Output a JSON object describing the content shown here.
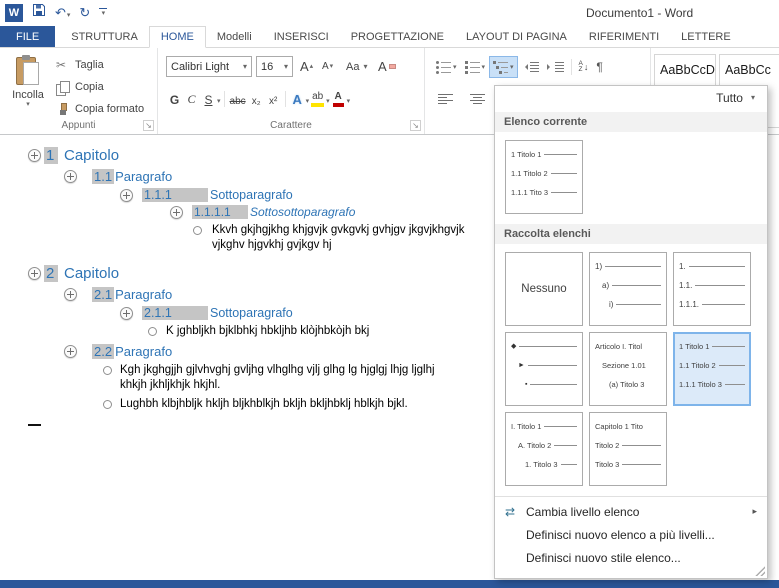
{
  "titlebar": {
    "title": "Documento1 - Word"
  },
  "icons": {
    "word": "W",
    "undo": "↶",
    "redo": "↻",
    "arrow": "▾",
    "up": "▴",
    "scissors": "✂",
    "pilcrow": "¶",
    "sort_a": "A",
    "sort_z": "Z",
    "sort_down": "↓",
    "launcher": "↘",
    "submenu": "▸",
    "change_level": "⇄"
  },
  "tabs": {
    "file": "FILE",
    "items": [
      "STRUTTURA",
      "HOME",
      "Modelli",
      "INSERISCI",
      "PROGETTAZIONE",
      "LAYOUT DI PAGINA",
      "RIFERIMENTI",
      "LETTERE"
    ]
  },
  "ribbon": {
    "clipboard": {
      "paste": "Incolla",
      "cut": "Taglia",
      "copy": "Copia",
      "format_painter": "Copia formato",
      "group": "Appunti"
    },
    "font": {
      "name": "Calibri Light",
      "size": "16",
      "grow": "A",
      "shrink": "A",
      "aa": "Aa",
      "clear": "A",
      "bold": "G",
      "italic": "C",
      "underline": "S",
      "strikethrough": "abc",
      "subscript": "x₂",
      "superscript": "x²",
      "effects": "A",
      "highlight": "ab",
      "color": "A",
      "group": "Carattere"
    },
    "styles": {
      "style1": "AaBbCcDc",
      "style2": "AaBbCc"
    }
  },
  "document": {
    "outline": [
      {
        "kind": "h1",
        "number": "1",
        "text": "Capitolo"
      },
      {
        "kind": "h2",
        "number": "1.1",
        "text": "Paragrafo"
      },
      {
        "kind": "h3",
        "number": "1.1.1",
        "text": "Sottoparagrafo"
      },
      {
        "kind": "h4",
        "number": "1.1.1.1",
        "text": "Sottosottoparagrafo"
      },
      {
        "kind": "body",
        "line1": "Kkvh gkjhgjkhg khjgvjk gvkgvkj gvhjgv jkgvjkhgvjk",
        "line2": "vjkghv hjgvkhj gvjkgv hj"
      },
      {
        "kind": "h1",
        "number": "2",
        "text": "Capitolo"
      },
      {
        "kind": "h2",
        "number": "2.1",
        "text": "Paragrafo"
      },
      {
        "kind": "h3",
        "number": "2.1.1",
        "text": "Sottoparagrafo"
      },
      {
        "kind": "body",
        "line1": "K jghbljkh bjklbhkj hbkljhb klòjhbkòjh bkj"
      },
      {
        "kind": "h2",
        "number": "2.2",
        "text": "Paragrafo"
      },
      {
        "kind": "body",
        "line1": "Kgh jkghgjjh gjlvhvghj gvljhg vlhglhg vjlj glhg lg hjglgj lhjg ljglhj",
        "line2": "khkjh jkhljkhjk hkjhl."
      },
      {
        "kind": "body",
        "line1": "Lughbh klbjhbljk hkljh bljkhblkjh bkljh bkljhbklj hblkjh bjkl."
      }
    ]
  },
  "dropdown": {
    "filter": "Tutto",
    "current_label": "Elenco corrente",
    "gallery_label": "Raccolta elenchi",
    "current": [
      "1 Titolo 1",
      "1.1 Titolo 2",
      "1.1.1 Tito 3"
    ],
    "cells": {
      "none": "Nessuno",
      "numparen": [
        "1)",
        "a)",
        "i)"
      ],
      "numdot": [
        "1.",
        "1.1.",
        "1.1.1."
      ],
      "bullets": [
        "◆",
        "►",
        "▪"
      ],
      "articolo": [
        "Articolo I. Titol",
        "Sezione 1.01",
        "(a) Titolo 3"
      ],
      "titolonum": [
        "1 Titolo 1",
        "1.1 Titolo 2",
        "1.1.1 Titolo 3"
      ],
      "roman": [
        "I. Titolo 1",
        "A. Titolo 2",
        "1. Titolo 3"
      ],
      "capitolo": [
        "Capitolo 1 Tito",
        "Titolo 2",
        "Titolo 3"
      ]
    },
    "menu": [
      {
        "label": "Cambia livello elenco"
      },
      {
        "label": "Definisci nuovo elenco a più livelli..."
      },
      {
        "label": "Definisci nuovo stile elenco..."
      }
    ]
  }
}
